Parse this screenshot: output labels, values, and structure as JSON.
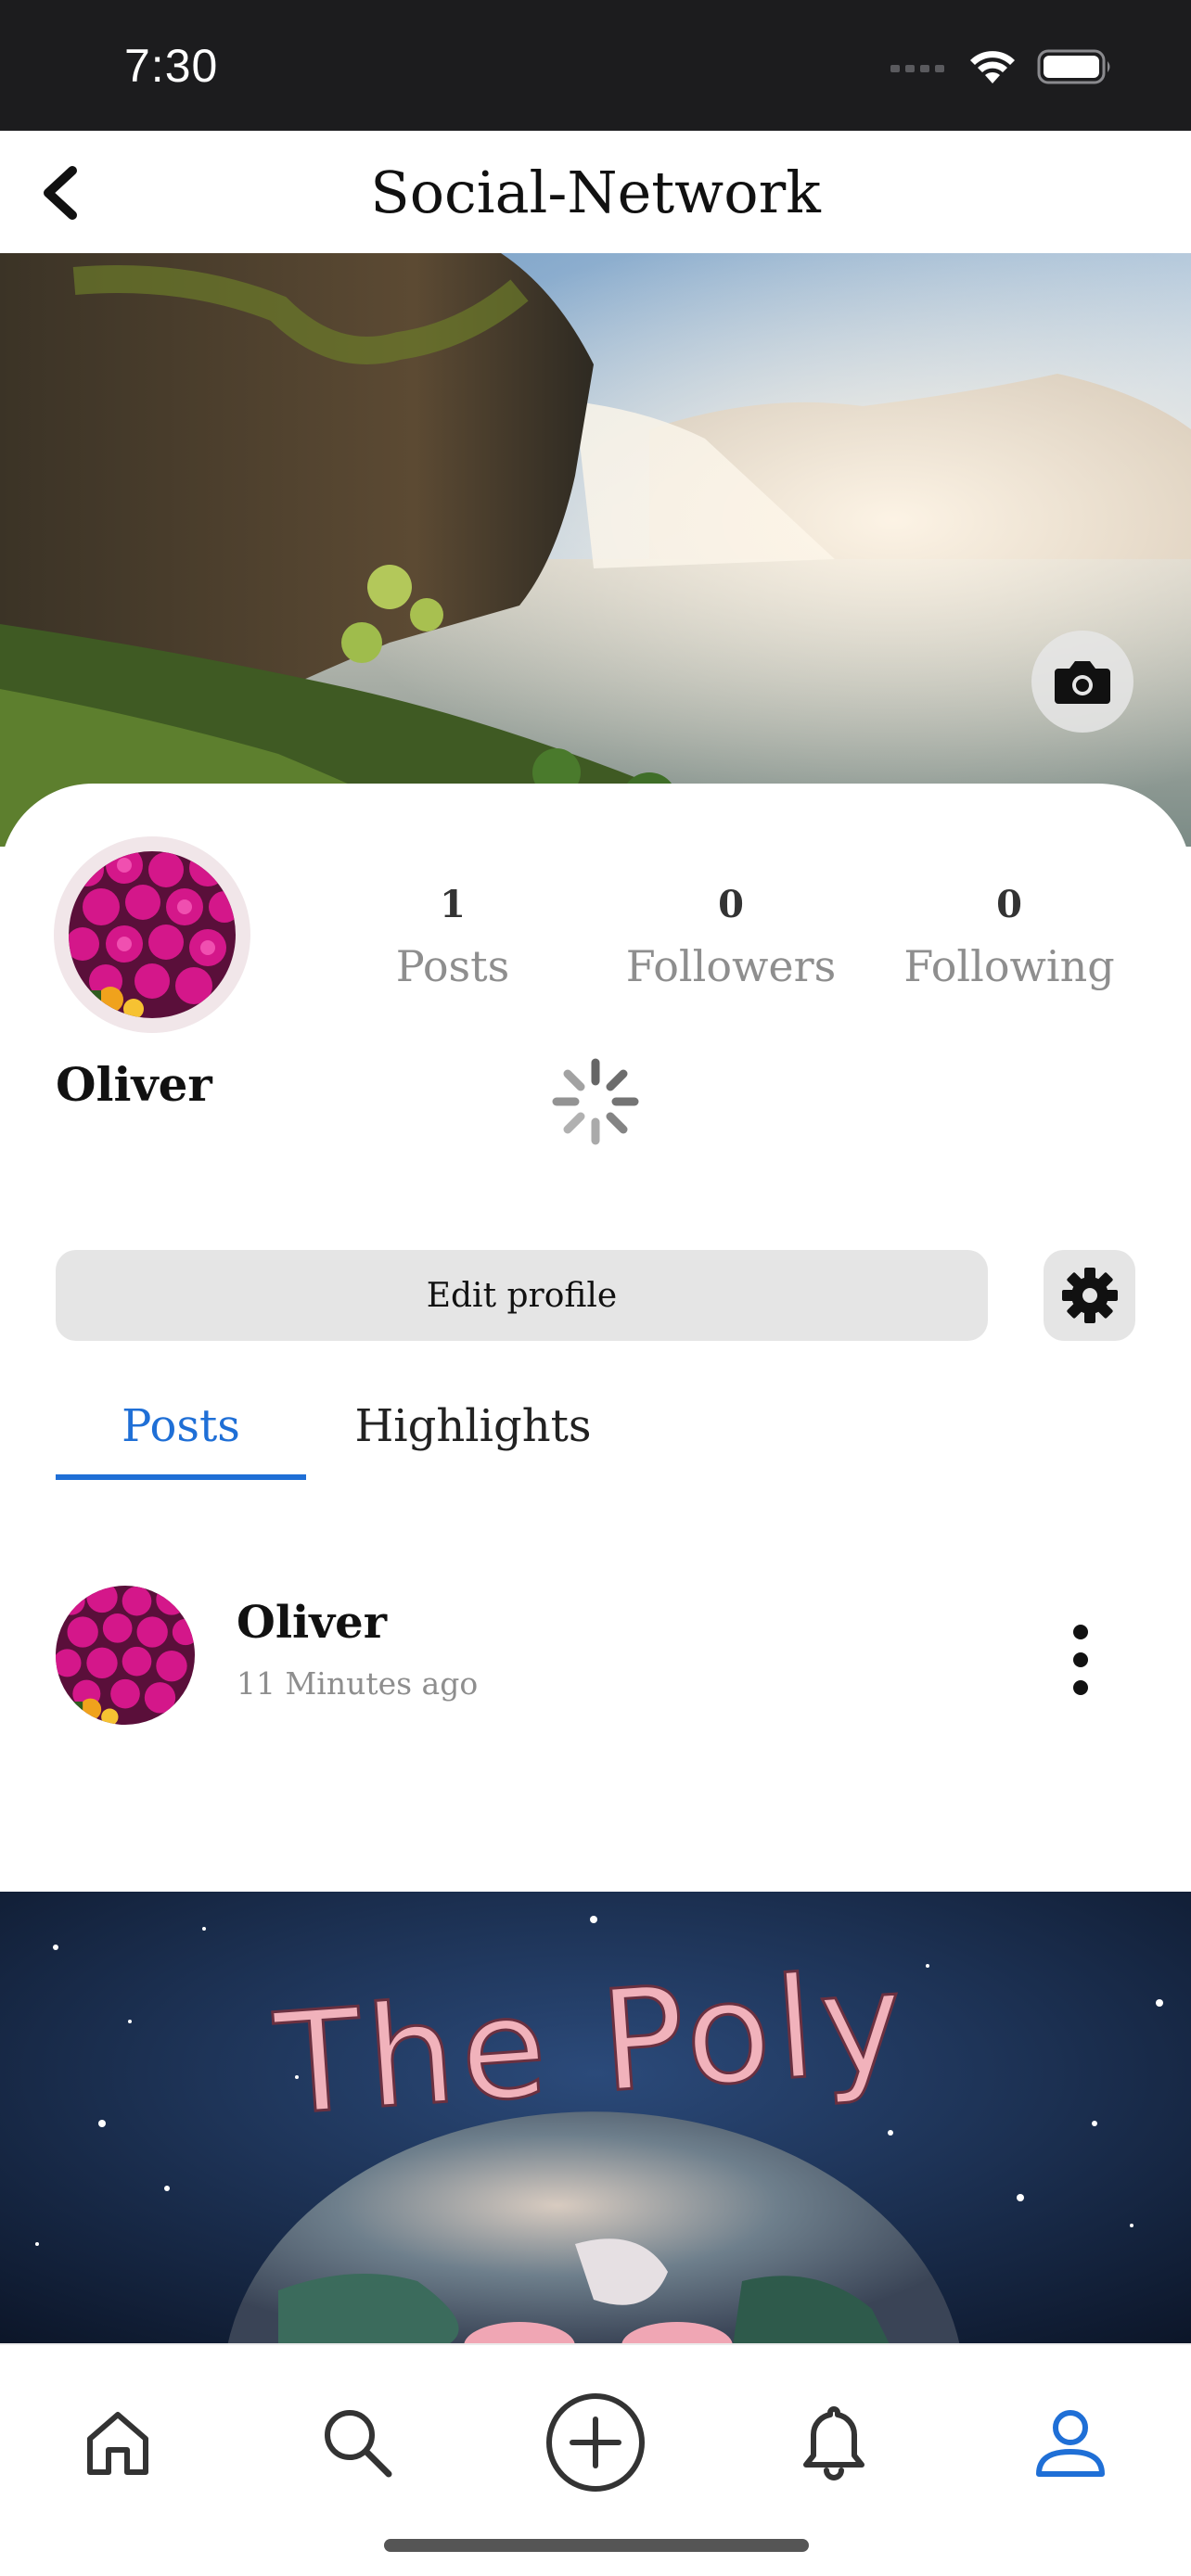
{
  "status_bar": {
    "time": "7:30",
    "icons": [
      "signal-icon",
      "wifi-icon",
      "battery-icon"
    ]
  },
  "nav": {
    "title": "Social-Network",
    "back_icon": "chevron-left-icon"
  },
  "cover": {
    "image": "waterfall landscape",
    "camera_icon": "camera-icon"
  },
  "profile": {
    "name": "Oliver",
    "avatar": "pink flowers",
    "stats": [
      {
        "count": "1",
        "label": "Posts"
      },
      {
        "count": "0",
        "label": "Followers"
      },
      {
        "count": "0",
        "label": "Following"
      }
    ],
    "loading": true,
    "edit_label": "Edit profile",
    "settings_icon": "gear-icon"
  },
  "tabs": [
    {
      "label": "Posts",
      "active": true
    },
    {
      "label": "Highlights",
      "active": false
    }
  ],
  "post": {
    "author": "Oliver",
    "time": "11 Minutes ago",
    "menu_icon": "more-vertical-icon",
    "image_text": "The Poly"
  },
  "tab_bar": {
    "items": [
      {
        "icon": "home-icon",
        "active": false
      },
      {
        "icon": "search-icon",
        "active": false
      },
      {
        "icon": "add-circle-icon",
        "active": false
      },
      {
        "icon": "bell-icon",
        "active": false
      },
      {
        "icon": "profile-icon",
        "active": true
      }
    ]
  },
  "colors": {
    "accent": "#1f6fd6",
    "status_bar": "#1c1c1e",
    "button_bg": "#e5e5e5",
    "muted_text": "#8e8e8e"
  }
}
